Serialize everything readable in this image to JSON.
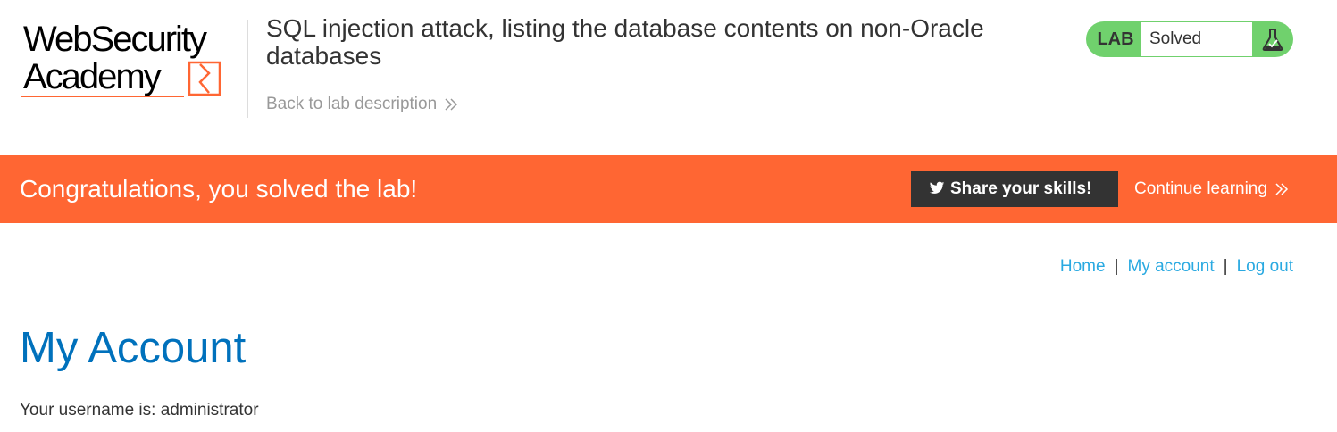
{
  "header": {
    "logo_line1": "WebSecurity",
    "logo_line2": "Academy",
    "lab_title": "SQL injection attack, listing the database contents on non-Oracle databases",
    "back_link": "Back to lab description",
    "lab_badge": {
      "label": "LAB",
      "status": "Solved",
      "icon": "flask-icon"
    }
  },
  "banner": {
    "message": "Congratulations, you solved the lab!",
    "share_button": "Share your skills!",
    "share_icon": "twitter-icon",
    "continue_link": "Continue learning"
  },
  "nav": {
    "items": [
      "Home",
      "My account",
      "Log out"
    ],
    "separator": "|"
  },
  "main": {
    "title": "My Account",
    "username_text": "Your username is: administrator"
  },
  "colors": {
    "brand_orange": "#ff6633",
    "badge_green": "#70d16d",
    "link_blue": "#29a9e1",
    "title_blue": "#0071bc",
    "dark_button": "#333333"
  }
}
